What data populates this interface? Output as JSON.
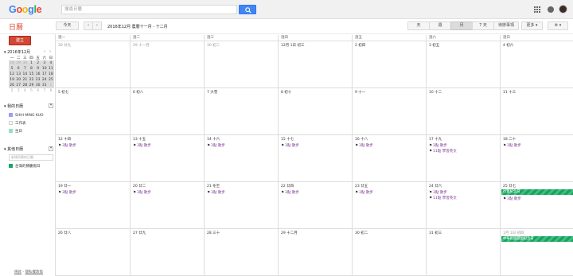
{
  "header": {
    "logo": {
      "letters": [
        "G",
        "o",
        "o",
        "g",
        "l",
        "e"
      ],
      "colors": [
        "#4285f4",
        "#ea4335",
        "#fbbc05",
        "#4285f4",
        "#34a853",
        "#ea4335"
      ]
    },
    "search_placeholder": "搜尋日曆",
    "icons": [
      "search-icon",
      "apps-grid-icon",
      "notifications-icon",
      "avatar"
    ]
  },
  "toolbar": {
    "brand": "日曆",
    "today_label": "今天",
    "prev_label": "‹",
    "next_label": "›",
    "date_range": "2016年12月 農曆十一月 - 十二月",
    "views": {
      "day": "天",
      "week": "週",
      "month": "月",
      "four_day": "7 天",
      "agenda": "待辦事項"
    },
    "more_label": "更多 ▾",
    "settings_label": "⚙ ▾",
    "active_view": "month"
  },
  "sidebar": {
    "create_label": "建立",
    "mini_calendar": {
      "title": "▾ 2016年12月",
      "prev": "‹",
      "next": "›",
      "weekday_headers": [
        "一",
        "二",
        "三",
        "四",
        "五",
        "六",
        "日"
      ],
      "rows": [
        [
          "28",
          "29",
          "30",
          "1",
          "2",
          "3",
          "4"
        ],
        [
          "5",
          "6",
          "7",
          "8",
          "9",
          "10",
          "11"
        ],
        [
          "12",
          "13",
          "14",
          "15",
          "16",
          "17",
          "18"
        ],
        [
          "19",
          "20",
          "21",
          "22",
          "23",
          "24",
          "25"
        ],
        [
          "26",
          "27",
          "28",
          "29",
          "30",
          "31",
          "1"
        ],
        [
          "2",
          "3",
          "4",
          "5",
          "6",
          "7",
          "8"
        ]
      ]
    },
    "my_calendars": {
      "title": "▾ 我的日曆",
      "items": [
        {
          "label": "SHIH MING KUO",
          "color": "#9a9cff"
        },
        {
          "label": "工作表",
          "color": "#ffffff"
        },
        {
          "label": "生日",
          "color": "#92e1c0"
        }
      ]
    },
    "other_calendars": {
      "title": "▾ 其他日曆",
      "search_placeholder": "新增同事的日曆",
      "items": [
        {
          "label": "台灣的節慶假日",
          "color": "#16a765"
        }
      ]
    },
    "footer": {
      "terms": "條款",
      "privacy": "隱私權政策",
      "sep": " - "
    }
  },
  "calendar": {
    "weekday_headers": [
      "週一",
      "週二",
      "週三",
      "週四",
      "週五",
      "週六",
      "週日"
    ],
    "weeks": [
      {
        "days": [
          {
            "label": "28 廿九",
            "muted": true
          },
          {
            "label": "29 十一月",
            "muted": true
          },
          {
            "label": "30 初二",
            "muted": true
          },
          {
            "label": "12月 1日 初三"
          },
          {
            "label": "2 初四"
          },
          {
            "label": "3 初五"
          },
          {
            "label": "4 初六"
          }
        ]
      },
      {
        "days": [
          {
            "label": "5 初七"
          },
          {
            "label": "6 初八"
          },
          {
            "label": "7 大雪"
          },
          {
            "label": "8 初十"
          },
          {
            "label": "9 十一"
          },
          {
            "label": "10 十二"
          },
          {
            "label": "11 十三"
          }
        ]
      },
      {
        "days": [
          {
            "label": "12 十四",
            "events": [
              {
                "cal": "3點",
                "title": "散步"
              }
            ]
          },
          {
            "label": "13 十五",
            "events": [
              {
                "cal": "3點",
                "title": "散步"
              }
            ]
          },
          {
            "label": "14 十六",
            "events": [
              {
                "cal": "3點",
                "title": "散步"
              }
            ]
          },
          {
            "label": "15 十七",
            "events": [
              {
                "cal": "3點",
                "title": "散步"
              }
            ]
          },
          {
            "label": "16 十八",
            "events": [
              {
                "cal": "3點",
                "title": "散步"
              }
            ]
          },
          {
            "label": "17 十九",
            "events": [
              {
                "cal": "3點",
                "title": "散步"
              },
              {
                "cal": "11點",
                "title": "學習英文"
              }
            ]
          },
          {
            "label": "18 二十",
            "events": [
              {
                "cal": "3點",
                "title": "散步"
              }
            ]
          }
        ]
      },
      {
        "days": [
          {
            "label": "19 廿一",
            "events": [
              {
                "cal": "3點",
                "title": "散步"
              }
            ]
          },
          {
            "label": "20 廿二",
            "events": [
              {
                "cal": "3點",
                "title": "散步"
              }
            ]
          },
          {
            "label": "21 冬至",
            "events": [
              {
                "cal": "3點",
                "title": "散步"
              }
            ]
          },
          {
            "label": "22 廿四",
            "events": [
              {
                "cal": "3點",
                "title": "散步"
              }
            ]
          },
          {
            "label": "23 廿五",
            "events": [
              {
                "cal": "3點",
                "title": "散步"
              }
            ]
          },
          {
            "label": "24 廿六",
            "events": [
              {
                "cal": "3點",
                "title": "散步"
              },
              {
                "cal": "11點",
                "title": "學習英文"
              }
            ]
          },
          {
            "label": "25 廿七",
            "allday": "行憲紀念日",
            "events": [
              {
                "cal": "3點",
                "title": "散步"
              }
            ]
          }
        ]
      },
      {
        "days": [
          {
            "label": "26 廿八"
          },
          {
            "label": "27 廿九"
          },
          {
            "label": "28 三十"
          },
          {
            "label": "29 十二月"
          },
          {
            "label": "30 初二"
          },
          {
            "label": "31 初三"
          },
          {
            "label": "1月 1日 初四",
            "muted": true,
            "allday": "中華民國開國紀念日"
          }
        ]
      }
    ]
  }
}
